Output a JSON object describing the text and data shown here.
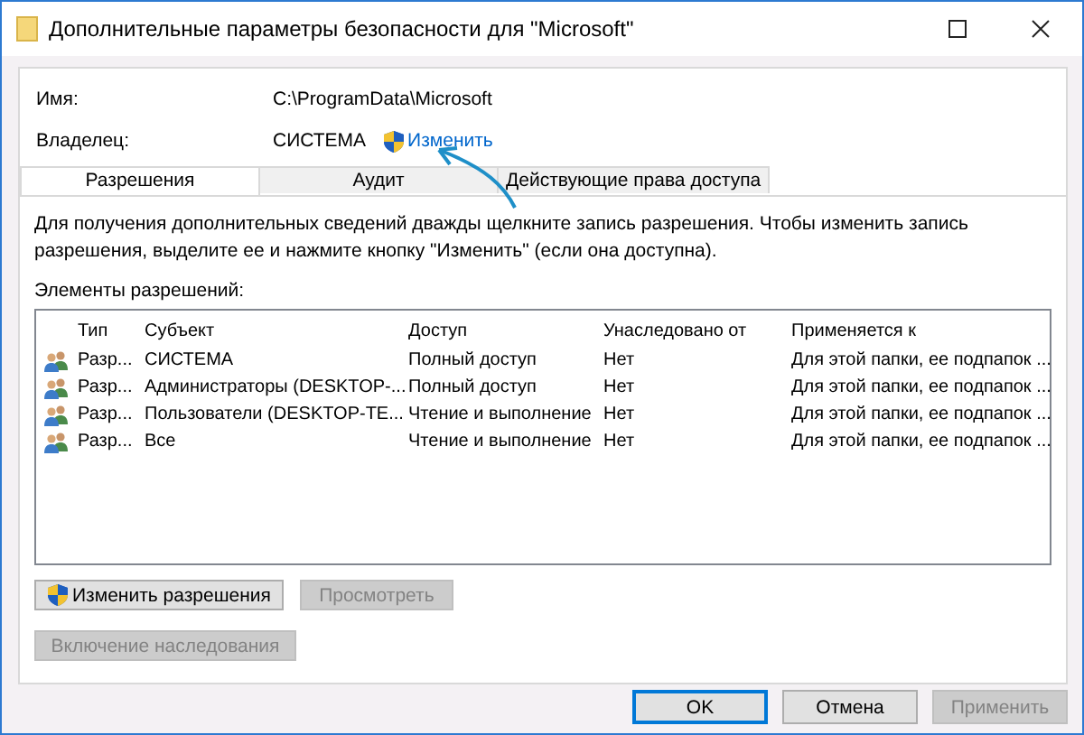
{
  "window": {
    "title": "Дополнительные параметры безопасности  для \"Microsoft\""
  },
  "info": [
    {
      "label": "Имя:",
      "value": "C:\\ProgramData\\Microsoft"
    },
    {
      "label": "Владелец:",
      "value": "СИСТЕМА",
      "link": "Изменить"
    }
  ],
  "tabs": [
    {
      "label": "Разрешения",
      "selected": true
    },
    {
      "label": "Аудит",
      "selected": false
    },
    {
      "label": "Действующие права доступа",
      "selected": false
    }
  ],
  "description": "Для получения дополнительных сведений дважды щелкните запись разрешения. Чтобы изменить запись разрешения, выделите ее и нажмите кнопку \"Изменить\" (если она доступна).",
  "list_label": "Элементы разрешений:",
  "table": {
    "columns": [
      "Тип",
      "Субъект",
      "Доступ",
      "Унаследовано от",
      "Применяется к"
    ],
    "rows": [
      [
        "Разр...",
        "СИСТЕМА",
        "Полный доступ",
        "Нет",
        "Для этой папки, ее подпапок ..."
      ],
      [
        "Разр...",
        "Администраторы (DESKTOP-...",
        "Полный доступ",
        "Нет",
        "Для этой папки, ее подпапок ..."
      ],
      [
        "Разр...",
        "Пользователи (DESKTOP-TE...",
        "Чтение и выполнение",
        "Нет",
        "Для этой папки, ее подпапок ..."
      ],
      [
        "Разр...",
        "Все",
        "Чтение и выполнение",
        "Нет",
        "Для этой папки, ее подпапок ..."
      ]
    ]
  },
  "actions": [
    [
      {
        "label": "Изменить разрешения",
        "shield": true,
        "disabled": false
      },
      {
        "label": "Просмотреть",
        "shield": false,
        "disabled": true
      }
    ],
    [
      {
        "label": "Включение наследования",
        "shield": false,
        "disabled": true
      }
    ]
  ],
  "footer": [
    {
      "label": "OK",
      "default": true,
      "disabled": false
    },
    {
      "label": "Отмена",
      "default": false,
      "disabled": false
    },
    {
      "label": "Применить",
      "default": false,
      "disabled": true
    }
  ]
}
